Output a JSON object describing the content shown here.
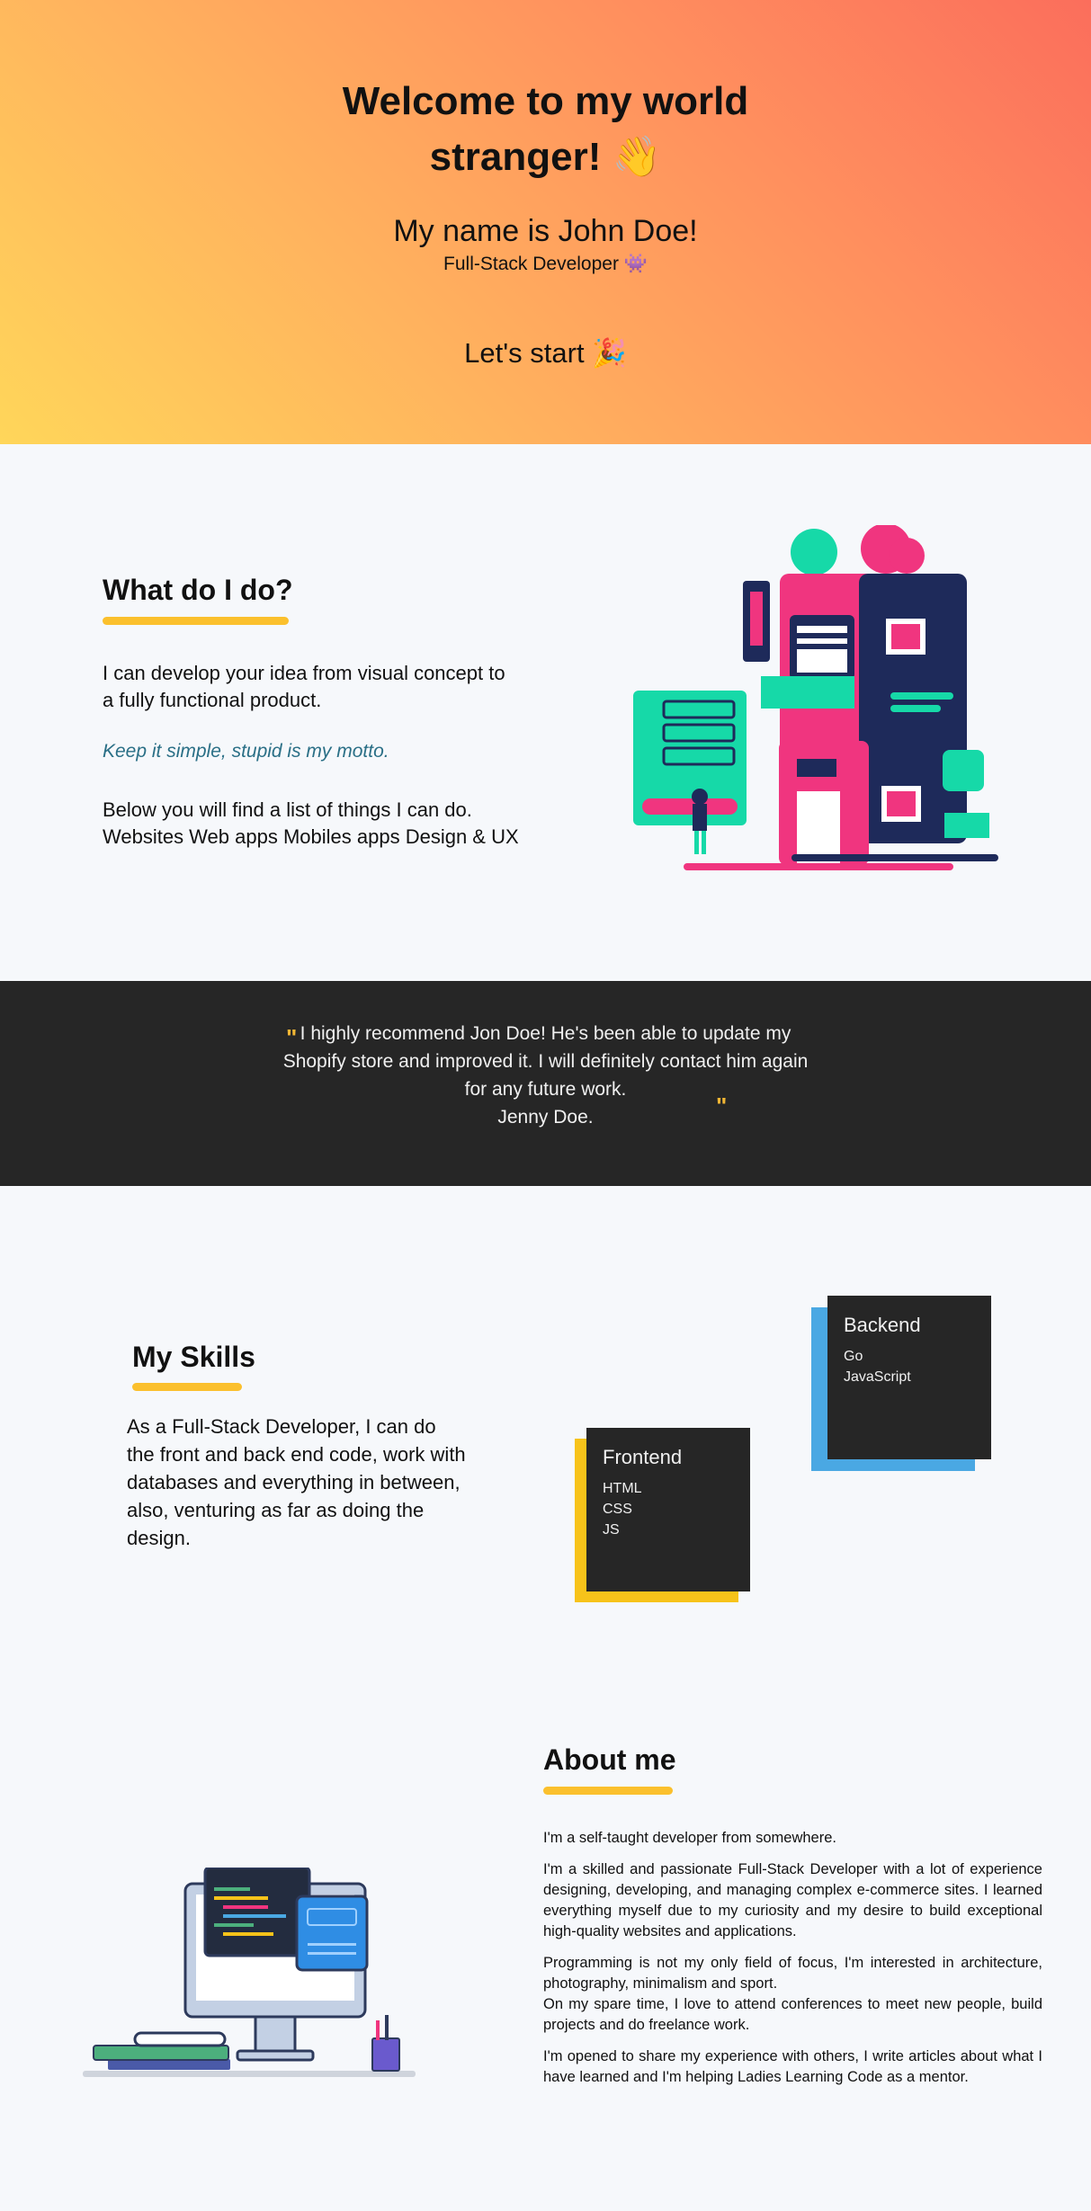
{
  "hero": {
    "title_line1": "Welcome to my world",
    "title_line2": "stranger! 👋",
    "name": "My name is John Doe!",
    "role": "Full-Stack Developer 👾",
    "cta": "Let's start 🎉",
    "gradient_colors": [
      "#ffd65a",
      "#fb6e5c"
    ]
  },
  "what": {
    "title": "What do I do?",
    "intro": "I can develop your idea from visual concept to a fully functional product.",
    "motto": "Keep it simple, stupid is my motto.",
    "list_line1": "Below you will find a list of things I can do.",
    "list_line2": "Websites Web apps Mobiles apps Design & UX",
    "illustration": "robot-building-illustration"
  },
  "testimonial": {
    "open_quote": "\"",
    "close_quote": "\"",
    "text": "I highly recommend Jon Doe! He's been able to update my Shopify store and improved it. I will definitely contact him again for any future work.",
    "author": "Jenny Doe."
  },
  "skills": {
    "title": "My Skills",
    "text": "As a Full-Stack Developer, I can do the front and back end code, work with databases and everything in between, also, venturing as far as doing the design.",
    "frontend": {
      "title": "Frontend",
      "items": [
        "HTML",
        "CSS",
        "JS"
      ],
      "accent": "#f7c31a"
    },
    "backend": {
      "title": "Backend",
      "items": [
        "Go",
        "JavaScript"
      ],
      "accent": "#4aa8e3"
    }
  },
  "about": {
    "title": "About me",
    "paragraphs": [
      "I'm a self-taught developer from somewhere.",
      "I'm a skilled and passionate Full-Stack Developer with a lot of experience designing, developing, and managing complex e-commerce sites. I learned everything myself due to my curiosity and my desire to build exceptional high-quality websites and applications.",
      "Programming is not my only field of focus, I'm interested in architecture, photography, minimalism and sport.",
      "On my spare time, I love to attend conferences to meet new people, build projects and do freelance work.",
      "I'm opened to share my experience with others, I write articles about what I have learned and I'm helping Ladies Learning Code as a mentor."
    ],
    "illustration": "computer-desk-illustration"
  },
  "colors": {
    "accent_yellow": "#fbc02d",
    "dark": "#262626",
    "motto": "#2a6f86",
    "background": "#f6f8fb"
  }
}
